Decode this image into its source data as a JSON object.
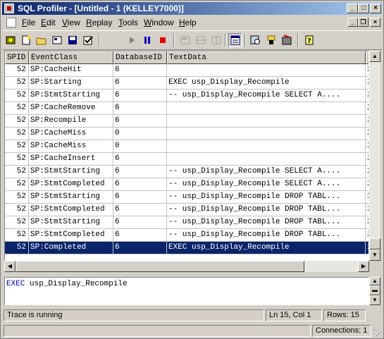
{
  "window": {
    "title": "SQL Profiler - [Untitled - 1 (KELLEY7000)]"
  },
  "menu": [
    {
      "label": "File",
      "u": "F",
      "rest": "ile"
    },
    {
      "label": "Edit",
      "u": "E",
      "rest": "dit"
    },
    {
      "label": "View",
      "u": "V",
      "rest": "iew"
    },
    {
      "label": "Replay",
      "u": "R",
      "rest": "eplay"
    },
    {
      "label": "Tools",
      "u": "T",
      "rest": "ools"
    },
    {
      "label": "Window",
      "u": "W",
      "rest": "indow"
    },
    {
      "label": "Help",
      "u": "H",
      "rest": "elp"
    }
  ],
  "toolbar": {
    "icons": [
      "new-trace-icon",
      "new-template-icon",
      "open-icon",
      "properties-icon",
      "save-icon",
      "checkbox-icon",
      "play-icon",
      "pause-icon",
      "stop-icon",
      "step-icon",
      "run-to-cursor-icon",
      "grid-icon",
      "events-window-icon",
      "find-icon",
      "filter-icon",
      "query-analyzer-icon",
      "help-icon"
    ]
  },
  "grid": {
    "columns": [
      "SPID",
      "EventClass",
      "DatabaseID",
      "TextData",
      "S"
    ],
    "rows": [
      {
        "spid": "52",
        "event": "SP:CacheHit",
        "db": "6",
        "text": "",
        "extra": "2"
      },
      {
        "spid": "52",
        "event": "SP:Starting",
        "db": "6",
        "text": "EXEC usp_Display_Recompile",
        "extra": "2"
      },
      {
        "spid": "52",
        "event": "SP:StmtStarting",
        "db": "6",
        "text": "-- usp_Display_Recompile  SELECT A....",
        "extra": "2"
      },
      {
        "spid": "52",
        "event": "SP:CacheRemove",
        "db": "6",
        "text": "",
        "extra": "2"
      },
      {
        "spid": "52",
        "event": "SP:Recompile",
        "db": "6",
        "text": "",
        "extra": "2"
      },
      {
        "spid": "52",
        "event": "SP:CacheMiss",
        "db": "0",
        "text": "",
        "extra": "2"
      },
      {
        "spid": "52",
        "event": "SP:CacheMiss",
        "db": "0",
        "text": "",
        "extra": "2"
      },
      {
        "spid": "52",
        "event": "SP:CacheInsert",
        "db": "6",
        "text": "",
        "extra": "2"
      },
      {
        "spid": "52",
        "event": "SP:StmtStarting",
        "db": "6",
        "text": "-- usp_Display_Recompile  SELECT A....",
        "extra": "2"
      },
      {
        "spid": "52",
        "event": "SP:StmtCompleted",
        "db": "6",
        "text": "-- usp_Display_Recompile  SELECT A....",
        "extra": "2"
      },
      {
        "spid": "52",
        "event": "SP:StmtStarting",
        "db": "6",
        "text": "-- usp_Display_Recompile  DROP TABL...",
        "extra": "2"
      },
      {
        "spid": "52",
        "event": "SP:StmtCompleted",
        "db": "6",
        "text": "-- usp_Display_Recompile  DROP TABL...",
        "extra": "2"
      },
      {
        "spid": "52",
        "event": "SP:StmtStarting",
        "db": "6",
        "text": "-- usp_Display_Recompile  DROP TABL...",
        "extra": "2"
      },
      {
        "spid": "52",
        "event": "SP:StmtCompleted",
        "db": "6",
        "text": "-- usp_Display_Recompile  DROP TABL...",
        "extra": "2"
      },
      {
        "spid": "52",
        "event": "SP:Completed",
        "db": "6",
        "text": "EXEC usp_Display_Recompile",
        "extra": "2",
        "selected": true
      }
    ]
  },
  "detail": {
    "keyword": "EXEC",
    "rest": " usp_Display_Recompile"
  },
  "status": {
    "message": "Trace is running",
    "position": "Ln 15, Col 1",
    "rows": "Rows: 15",
    "connections": "Connections: 1"
  },
  "colors": {
    "titlebar": "#0a246a",
    "selection": "#0a246a",
    "keyword": "#0000cc"
  }
}
